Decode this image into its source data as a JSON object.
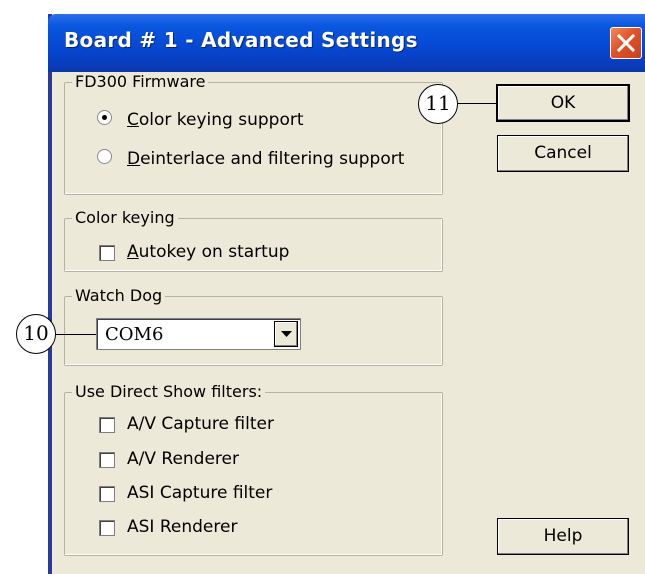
{
  "window": {
    "title": "Board # 1 - Advanced Settings",
    "close_icon": "close-icon"
  },
  "firmware": {
    "label": "FD300 Firmware",
    "options": [
      {
        "accel": "C",
        "rest": "olor keying support",
        "selected": true
      },
      {
        "accel": "D",
        "rest": "einterlace and filtering support",
        "selected": false
      }
    ]
  },
  "color_keying": {
    "label": "Color keying",
    "autokey": {
      "accel": "A",
      "rest": "utokey on startup",
      "checked": false
    }
  },
  "watchdog": {
    "label": "Watch Dog",
    "selected": "COM6",
    "arrow_icon": "chevron-down-icon"
  },
  "directshow": {
    "label": "Use Direct Show filters:",
    "items": [
      {
        "label": "A/V Capture filter",
        "checked": false
      },
      {
        "label": "A/V Renderer",
        "checked": false
      },
      {
        "label": "ASI Capture filter",
        "checked": false
      },
      {
        "label": "ASI Renderer",
        "checked": false
      }
    ]
  },
  "buttons": {
    "ok": "OK",
    "cancel": "Cancel",
    "help": "Help"
  },
  "callouts": {
    "ok": "11",
    "combo": "10"
  },
  "colors": {
    "titlebar": "#0a57e0",
    "dialog_bg": "#ece9d8",
    "close": "#e0532a"
  }
}
